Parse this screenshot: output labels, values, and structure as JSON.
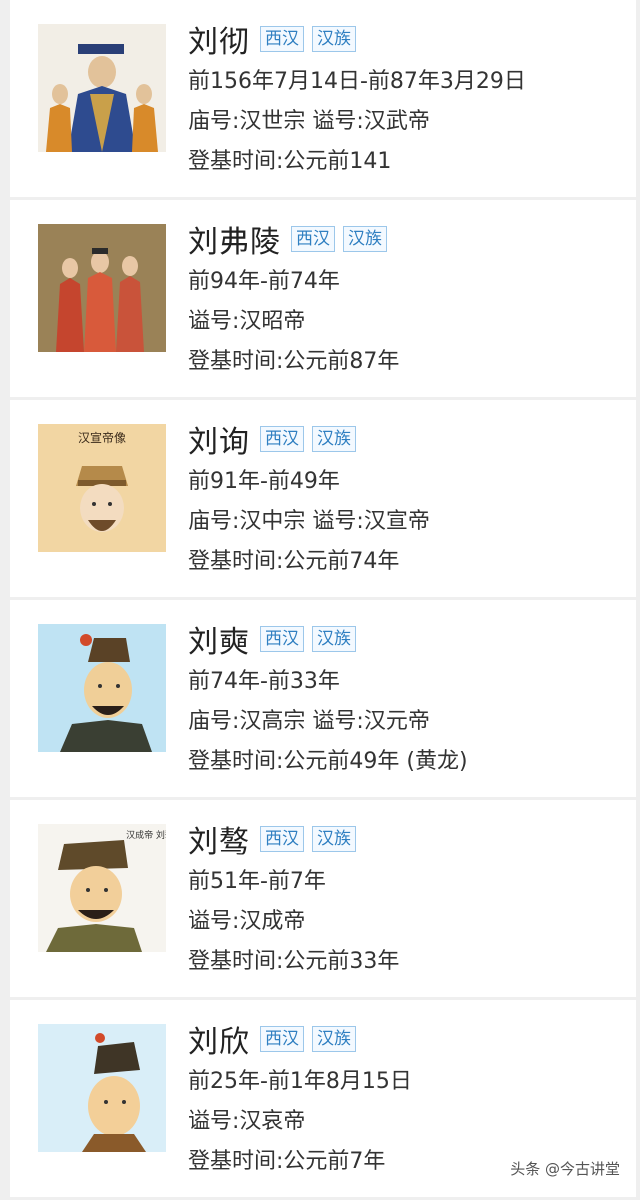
{
  "tags": {
    "dynasty": "西汉",
    "ethnicity": "汉族"
  },
  "emperors": [
    {
      "name": "刘彻",
      "dates": "前156年7月14日-前87年3月29日",
      "titles": "庙号:汉世宗 谥号:汉武帝",
      "accession": "登基时间:公元前141"
    },
    {
      "name": "刘弗陵",
      "dates": "前94年-前74年",
      "titles": "谥号:汉昭帝",
      "accession": "登基时间:公元前87年"
    },
    {
      "name": "刘询",
      "dates": "前91年-前49年",
      "titles": "庙号:汉中宗 谥号:汉宣帝",
      "accession": "登基时间:公元前74年"
    },
    {
      "name": "刘奭",
      "dates": "前74年-前33年",
      "titles": "庙号:汉高宗 谥号:汉元帝",
      "accession": "登基时间:公元前49年 (黄龙)"
    },
    {
      "name": "刘骜",
      "dates": "前51年-前7年",
      "titles": "谥号:汉成帝",
      "accession": "登基时间:公元前33年"
    },
    {
      "name": "刘欣",
      "dates": "前25年-前1年8月15日",
      "titles": "谥号:汉哀帝",
      "accession": "登基时间:公元前7年"
    }
  ],
  "portrait_captions": {
    "xuan": "汉宣帝像",
    "cheng": "汉成帝 刘骜"
  },
  "watermark": "头条 @今古讲堂"
}
